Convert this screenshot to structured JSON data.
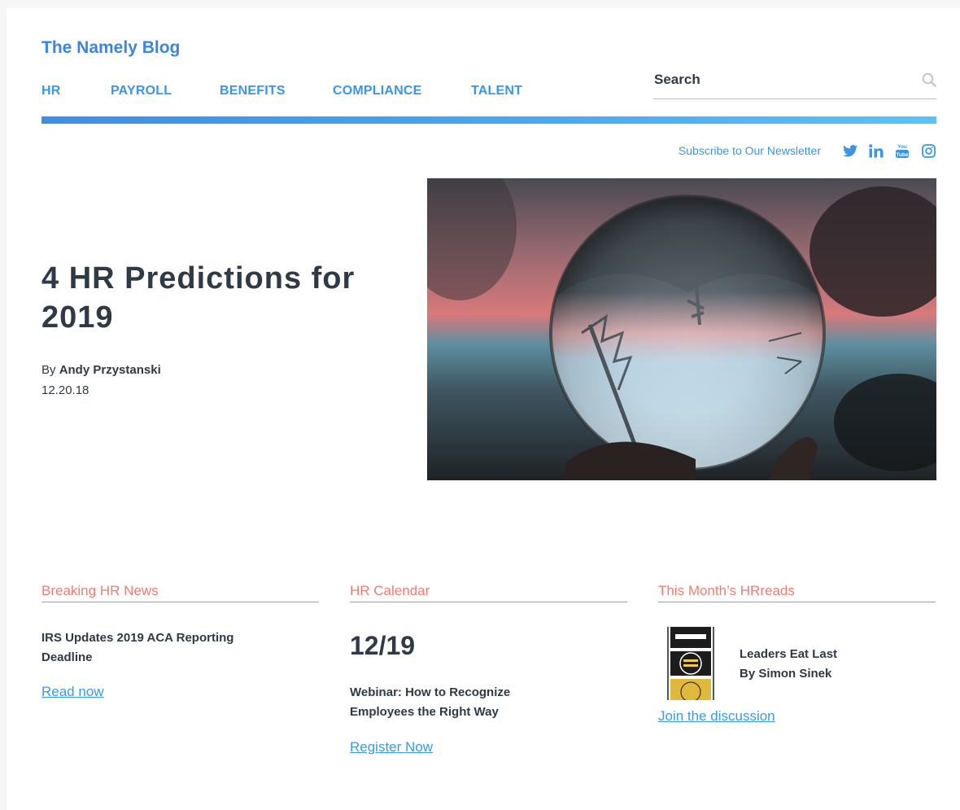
{
  "header": {
    "blog_title": "The Namely Blog",
    "nav": [
      "HR",
      "PAYROLL",
      "BENEFITS",
      "COMPLIANCE",
      "TALENT"
    ],
    "search_placeholder": "Search",
    "accent_color": "#3b95e6"
  },
  "social": {
    "newsletter_label": "Subscribe to Our Newsletter",
    "icons": [
      "twitter-icon",
      "linkedin-icon",
      "youtube-icon",
      "instagram-icon"
    ]
  },
  "article": {
    "title": "4 HR Predictions for 2019",
    "by_prefix": "By",
    "author": "Andy Przystanski",
    "date": "12.20.18"
  },
  "sections": {
    "news": {
      "heading": "Breaking HR News",
      "headline": "IRS Updates 2019 ACA Reporting Deadline",
      "link": "Read now"
    },
    "calendar": {
      "heading": "HR Calendar",
      "date": "12/19",
      "event": "Webinar: How to Recognize Employees the Right Way",
      "link": "Register Now"
    },
    "reads": {
      "heading": "This Month’s HRreads",
      "book_title": "Leaders Eat Last",
      "book_author": "By Simon Sinek",
      "link": "Join the discussion"
    },
    "heading_color": "#ee7d73"
  }
}
